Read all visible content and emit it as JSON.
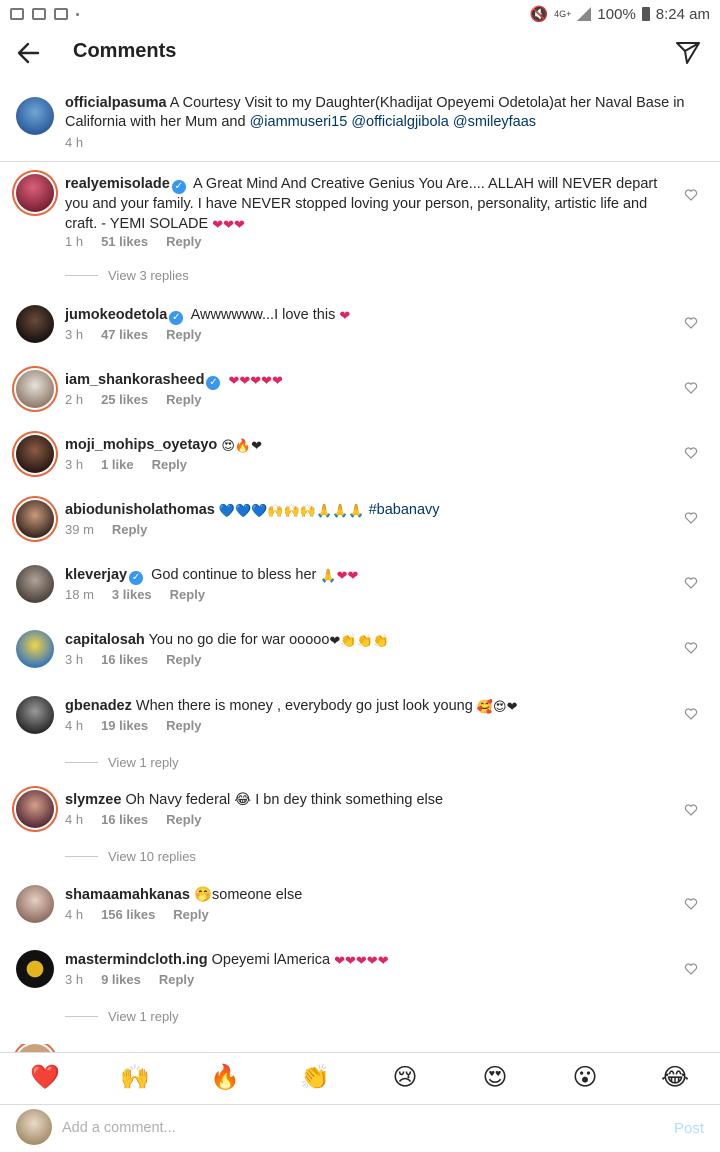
{
  "status_bar": {
    "network": "4G+",
    "battery": "100%",
    "time": "8:24 am"
  },
  "header": {
    "title": "Comments"
  },
  "caption": {
    "username": "officialpasuma",
    "text": "A Courtesy Visit to my Daughter(Khadijat Opeyemi Odetola)at her Naval Base in California with her Mum and",
    "mentions": [
      "@iammuseri15",
      "@officialgjibola",
      "@smileyfaas"
    ],
    "time": "4 h"
  },
  "comments": [
    {
      "username": "realyemisolade",
      "verified": true,
      "text": "A Great Mind And Creative Genius You Are.... ALLAH will NEVER depart you and your family. I have NEVER stopped loving your person, personality, artistic life and craft. - YEMI SOLADE",
      "emoji": "❤❤❤",
      "time": "1 h",
      "likes": "51 likes",
      "reply": "Reply",
      "view_replies": "View 3 replies"
    },
    {
      "username": "jumokeodetola",
      "verified": true,
      "text": "Awwwwww...I love this",
      "emoji": "❤",
      "time": "3 h",
      "likes": "47 likes",
      "reply": "Reply"
    },
    {
      "username": "iam_shankorasheed",
      "verified": true,
      "text": "",
      "emoji": "❤❤❤❤❤",
      "time": "2 h",
      "likes": "25 likes",
      "reply": "Reply"
    },
    {
      "username": "moji_mohips_oyetayo",
      "verified": false,
      "text": "",
      "emoji": "😍🔥❤",
      "time": "3 h",
      "likes": "1 like",
      "reply": "Reply"
    },
    {
      "username": "abiodunisholathomas",
      "verified": false,
      "text": "",
      "emoji": "💙💙💙🙌🙌🙌🙏🙏🙏",
      "hashtag": "#babanavy",
      "time": "39 m",
      "likes": "",
      "reply": "Reply"
    },
    {
      "username": "kleverjay",
      "verified": true,
      "text": "God continue to bless her",
      "emoji": "🙏❤❤",
      "time": "18 m",
      "likes": "3 likes",
      "reply": "Reply"
    },
    {
      "username": "capitalosah",
      "verified": false,
      "text": "You no go die for war ooooo",
      "emoji": "❤👏👏👏",
      "time": "3 h",
      "likes": "16 likes",
      "reply": "Reply"
    },
    {
      "username": "gbenadez",
      "verified": false,
      "text": "When there is money , everybody go just look young",
      "emoji": "🥰😍❤",
      "time": "4 h",
      "likes": "19 likes",
      "reply": "Reply",
      "view_replies": "View 1 reply"
    },
    {
      "username": "slymzee",
      "verified": false,
      "text": "Oh Navy federal 😂 I bn dey think something else",
      "emoji": "",
      "time": "4 h",
      "likes": "16 likes",
      "reply": "Reply",
      "view_replies": "View 10 replies"
    },
    {
      "username": "shamaamahkanas",
      "verified": false,
      "text": "🤭someone else",
      "emoji": "",
      "time": "4 h",
      "likes": "156 likes",
      "reply": "Reply"
    },
    {
      "username": "mastermindcloth.ing",
      "verified": false,
      "text": "Opeyemi lAmerica",
      "emoji": "❤❤❤❤❤",
      "time": "3 h",
      "likes": "9 likes",
      "reply": "Reply",
      "view_replies": "View 1 reply"
    }
  ],
  "emoji_bar": [
    "❤️",
    "🙌",
    "🔥",
    "👏",
    "😢",
    "😍",
    "😮",
    "😂"
  ],
  "composer": {
    "placeholder": "Add a comment...",
    "post_label": "Post"
  }
}
